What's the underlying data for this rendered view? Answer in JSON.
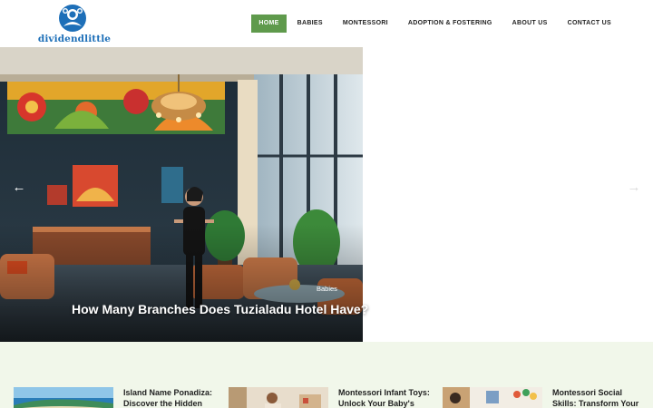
{
  "brand": {
    "name": "dividendlittle",
    "accent": "#5f9a4c",
    "logo_color": "#1d6fb8"
  },
  "nav": {
    "items": [
      {
        "label": "HOME",
        "active": true
      },
      {
        "label": "BABIES",
        "active": false
      },
      {
        "label": "MONTESSORI",
        "active": false
      },
      {
        "label": "ADOPTION & FOSTERING",
        "active": false
      },
      {
        "label": "ABOUT US",
        "active": false
      },
      {
        "label": "CONTACT US",
        "active": false
      }
    ]
  },
  "slider": {
    "category": "Babies",
    "title": "How Many Branches Does Tuzialadu Hotel Have?",
    "prev_icon": "arrow-left-icon",
    "next_icon": "arrow-right-icon"
  },
  "posts": [
    {
      "title": "Island Name Ponadiza: Discover the Hidden",
      "thumb": "coastline-image"
    },
    {
      "title": "Montessori Infant Toys: Unlock Your Baby's",
      "thumb": "nursery-image"
    },
    {
      "title": "Montessori Social Skills: Transform Your",
      "thumb": "classroom-image"
    }
  ]
}
